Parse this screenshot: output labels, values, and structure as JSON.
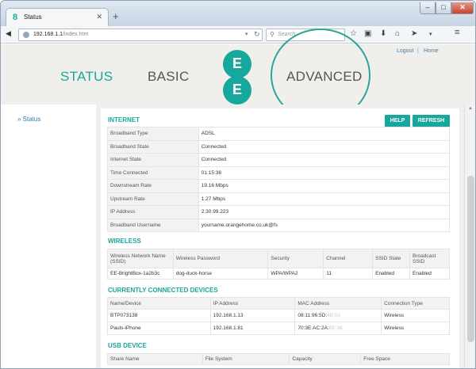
{
  "browser": {
    "tab_title": "Status",
    "tab_favicon": "ee-logo-icon",
    "url_host": "192.168.1.1",
    "url_path": "/index.htm",
    "search_placeholder": "Search"
  },
  "header": {
    "logout": "Logout",
    "separator": "|",
    "home": "Home",
    "nav": {
      "status": "STATUS",
      "basic": "BASIC",
      "advanced": "ADVANCED"
    },
    "logo_letters": [
      "E",
      "E"
    ]
  },
  "sidebar": {
    "items": [
      {
        "label": "Status"
      }
    ]
  },
  "internet": {
    "title": "INTERNET",
    "help": "HELP",
    "refresh": "REFRESH",
    "rows": [
      {
        "label": "Broadband Type",
        "value": "ADSL"
      },
      {
        "label": "Broadband State",
        "value": "Connected"
      },
      {
        "label": "Internet State",
        "value": "Connected"
      },
      {
        "label": "Time Connected",
        "value": "01:15:38"
      },
      {
        "label": "Downstream Rate",
        "value": "19.16 Mbps"
      },
      {
        "label": "Upstream Rate",
        "value": "1.27 Mbps"
      },
      {
        "label": "IP Address",
        "value": "2.30.99.223"
      },
      {
        "label": "Broadband Username",
        "value": "yourname.orangehome.co.uk@fs"
      }
    ]
  },
  "wireless": {
    "title": "WIRELESS",
    "headers": [
      "Wireless Network Name (SSID)",
      "Wireless Password",
      "Security",
      "Channel",
      "SSID State",
      "Broadcast SSID"
    ],
    "row": [
      "EE-BrightBox-1a2b3c",
      "dog-duck-horse",
      "WPA/WPA2",
      "11",
      "Enabled",
      "Enabled"
    ]
  },
  "devices": {
    "title": "CURRENTLY CONNECTED DEVICES",
    "headers": [
      "Name/Device",
      "IP Address",
      "MAC Address",
      "Connection Type"
    ],
    "rows": [
      {
        "name": "BTP073138",
        "ip": "192.168.1.13",
        "mac": "08:11:96:5D:",
        "mac_hidden": "4B:50",
        "type": "Wireless"
      },
      {
        "name": "Pauls-iPhone",
        "ip": "192.168.1.81",
        "mac": "70:3E:AC:2A:",
        "mac_hidden": "6E:36",
        "type": "Wireless"
      }
    ]
  },
  "usb": {
    "title": "USB DEVICE",
    "headers": [
      "Share Name",
      "File System",
      "Capacity",
      "Free Space"
    ]
  },
  "colors": {
    "brand": "#17a79d",
    "link": "#3a7fb4"
  }
}
